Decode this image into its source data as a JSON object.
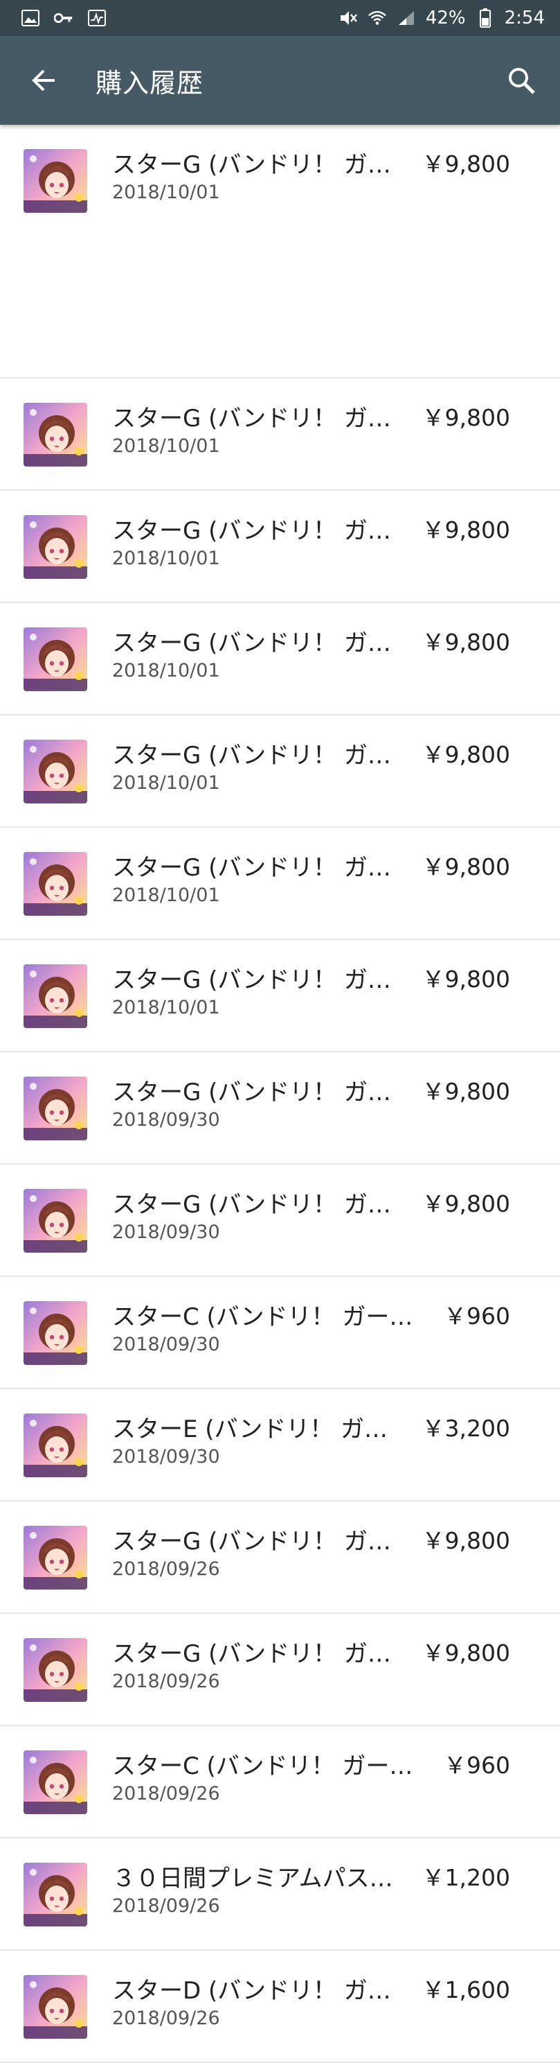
{
  "status_bar": {
    "battery": "42%",
    "time": "2:54",
    "icons": [
      "image-icon",
      "key-icon",
      "activity-icon",
      "mute-icon",
      "wifi-icon",
      "signal-icon",
      "battery-icon"
    ]
  },
  "app_bar": {
    "title": "購入履歴",
    "back_icon": "arrow-left-icon",
    "search_icon": "search-icon"
  },
  "purchases": [
    {
      "name": "スターG (バンドリ！ ガ…",
      "date": "2018/10/01",
      "price": "￥9,800"
    },
    {
      "name": "スターG (バンドリ！ ガ…",
      "date": "2018/10/01",
      "price": "￥9,800"
    },
    {
      "name": "スターG (バンドリ！ ガ…",
      "date": "2018/10/01",
      "price": "￥9,800"
    },
    {
      "name": "スターG (バンドリ！ ガ…",
      "date": "2018/10/01",
      "price": "￥9,800"
    },
    {
      "name": "スターG (バンドリ！ ガ…",
      "date": "2018/10/01",
      "price": "￥9,800"
    },
    {
      "name": "スターG (バンドリ！ ガ…",
      "date": "2018/10/01",
      "price": "￥9,800"
    },
    {
      "name": "スターG (バンドリ！ ガ…",
      "date": "2018/10/01",
      "price": "￥9,800"
    },
    {
      "name": "スターG (バンドリ！ ガ…",
      "date": "2018/09/30",
      "price": "￥9,800"
    },
    {
      "name": "スターG (バンドリ！ ガ…",
      "date": "2018/09/30",
      "price": "￥9,800"
    },
    {
      "name": "スターC (バンドリ！ ガー…",
      "date": "2018/09/30",
      "price": "￥960"
    },
    {
      "name": "スターE (バンドリ！ ガ…",
      "date": "2018/09/30",
      "price": "￥3,200"
    },
    {
      "name": "スターG (バンドリ！ ガ…",
      "date": "2018/09/26",
      "price": "￥9,800"
    },
    {
      "name": "スターG (バンドリ！ ガ…",
      "date": "2018/09/26",
      "price": "￥9,800"
    },
    {
      "name": "スターC (バンドリ！ ガー…",
      "date": "2018/09/26",
      "price": "￥960"
    },
    {
      "name": "３０日間プレミアムパス…",
      "date": "2018/09/26",
      "price": "￥1,200"
    },
    {
      "name": "スターD (バンドリ！ ガ…",
      "date": "2018/09/26",
      "price": "￥1,600"
    }
  ],
  "colors": {
    "status_bar": "#37474f",
    "app_bar": "#455a64",
    "divider": "#e6e6e6"
  }
}
